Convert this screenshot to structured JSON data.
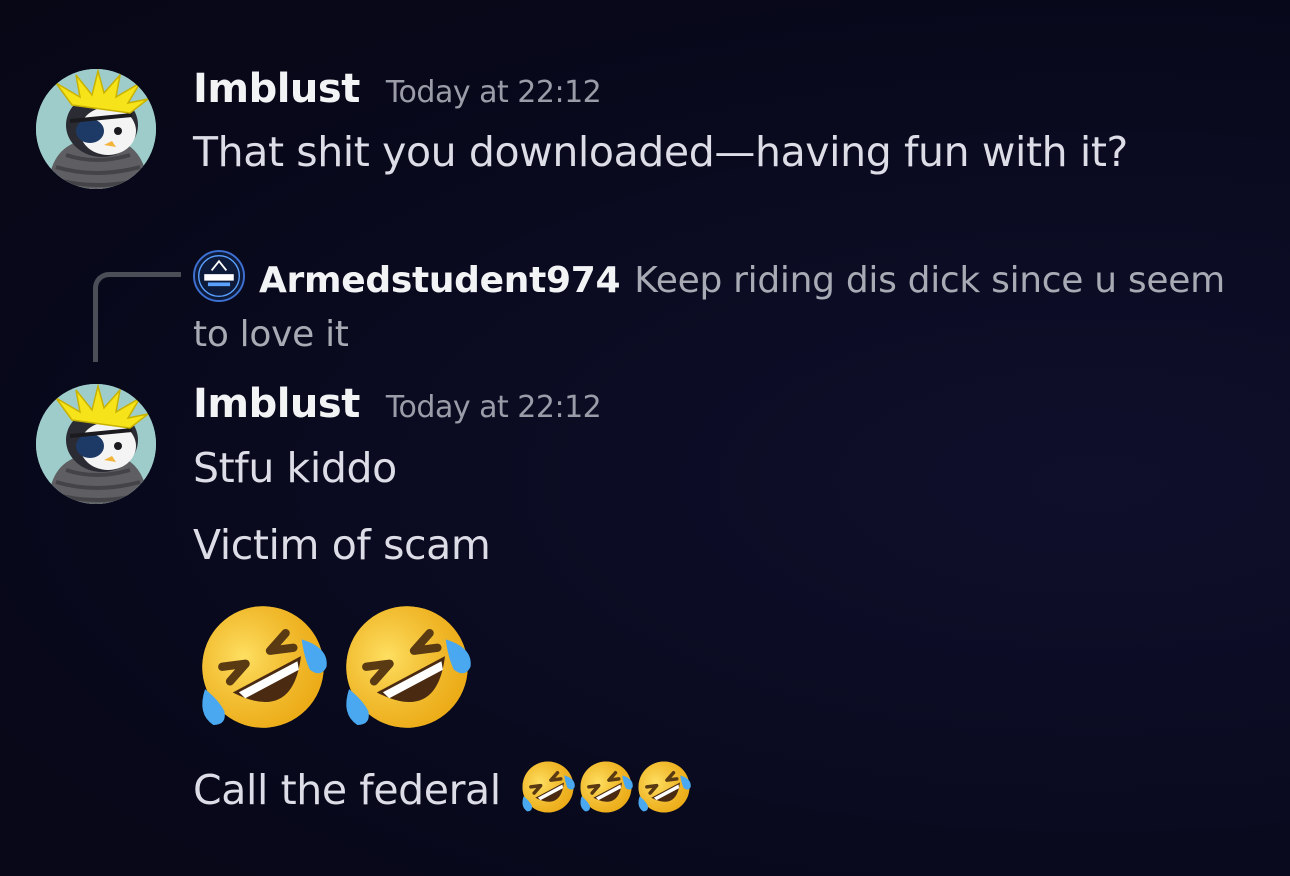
{
  "messages": [
    {
      "author": "Imblust",
      "timestamp": "Today at 22:12",
      "lines": [
        "That shit you downloaded—having fun with it?"
      ]
    },
    {
      "author": "Imblust",
      "timestamp": "Today at 22:12",
      "reply": {
        "author": "Armedstudent974",
        "text": "Keep riding dis dick since u seem to love it"
      },
      "lines": [
        "Stfu kiddo",
        "Victim of scam"
      ],
      "big_emojis": [
        "rolling-on-floor-laughing",
        "rolling-on-floor-laughing"
      ],
      "last_line": {
        "text": "Call the federal",
        "emojis": [
          "rolling-on-floor-laughing",
          "rolling-on-floor-laughing",
          "rolling-on-floor-laughing"
        ]
      }
    }
  ],
  "colors": {
    "background": "#08081a",
    "username": "#f2f3f5",
    "timestamp": "#9a9ca8",
    "text": "#dcdde6",
    "reply_text": "#a8aab4",
    "reply_spine": "#4b4d57"
  },
  "icons": {
    "avatar": "penguin-avatar-icon",
    "reply_avatar": "albion-logo-avatar-icon",
    "emoji": "rolling-on-floor-laughing-emoji-icon"
  }
}
